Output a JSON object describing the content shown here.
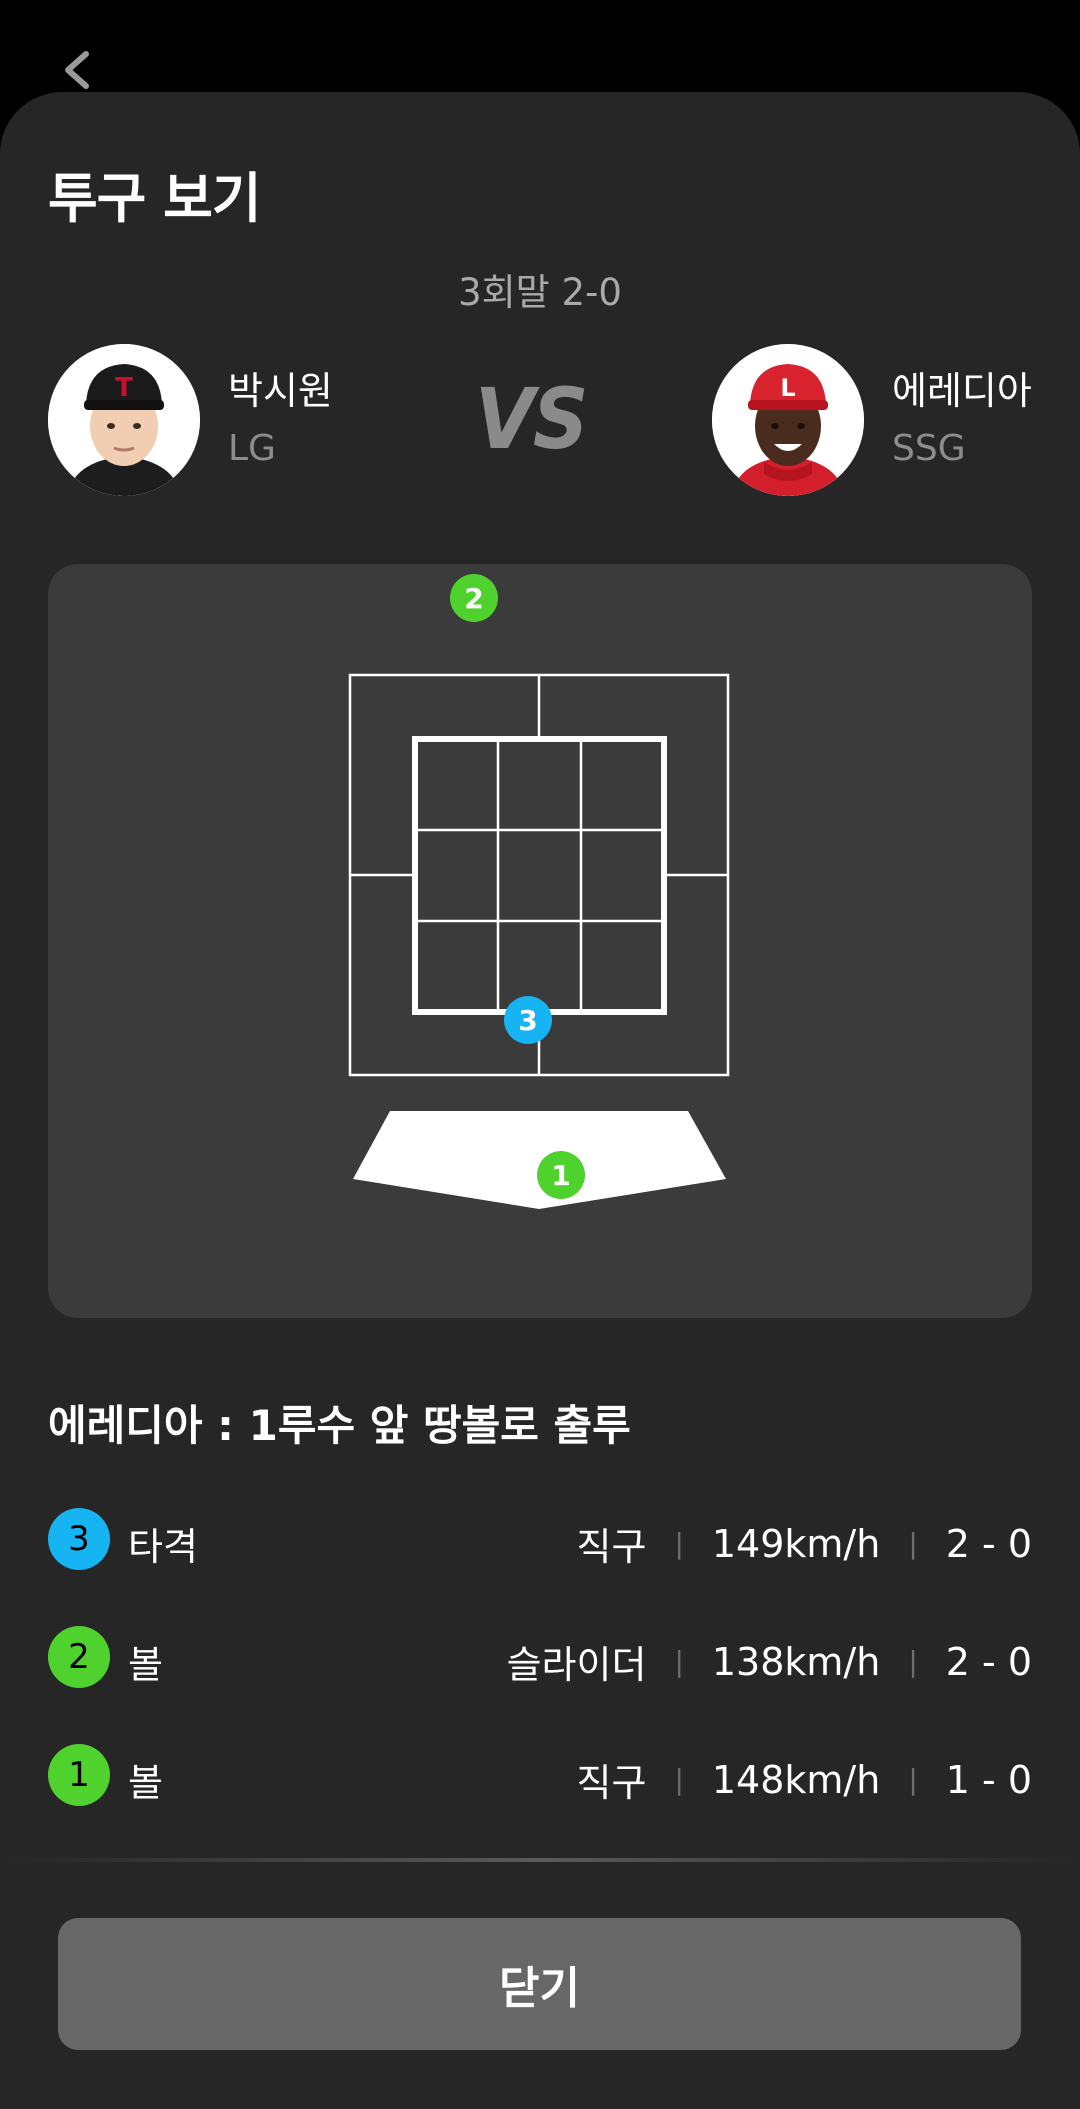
{
  "header": {
    "back_icon": "chevron-left-icon",
    "title": "투구 보기",
    "inning_score": "3회말 2-0"
  },
  "matchup": {
    "pitcher": {
      "name": "박시원",
      "team": "LG"
    },
    "vs_label": "VS",
    "batter": {
      "name": "에레디아",
      "team": "SSG"
    }
  },
  "colors": {
    "ball_green": "#4fd12e",
    "hit_blue": "#16b4f2",
    "sheet_bg": "#262626",
    "panel_bg": "#3b3b3b",
    "button_bg": "#676767"
  },
  "zone_markers": [
    {
      "number": "2",
      "type": "ball",
      "color": "#4fd12e"
    },
    {
      "number": "3",
      "type": "hit",
      "color": "#16b4f2"
    },
    {
      "number": "1",
      "type": "ball",
      "color": "#4fd12e"
    }
  ],
  "result": {
    "text": "에레디아 : 1루수 앞 땅볼로 출루"
  },
  "pitches": [
    {
      "number": "3",
      "label": "타격",
      "pitch_type": "직구",
      "speed": "149km/h",
      "count": "2 - 0",
      "color": "#16b4f2"
    },
    {
      "number": "2",
      "label": "볼",
      "pitch_type": "슬라이더",
      "speed": "138km/h",
      "count": "2 - 0",
      "color": "#4fd12e"
    },
    {
      "number": "1",
      "label": "볼",
      "pitch_type": "직구",
      "speed": "148km/h",
      "count": "1 - 0",
      "color": "#4fd12e"
    }
  ],
  "separator": "|",
  "close_button": {
    "label": "닫기"
  }
}
